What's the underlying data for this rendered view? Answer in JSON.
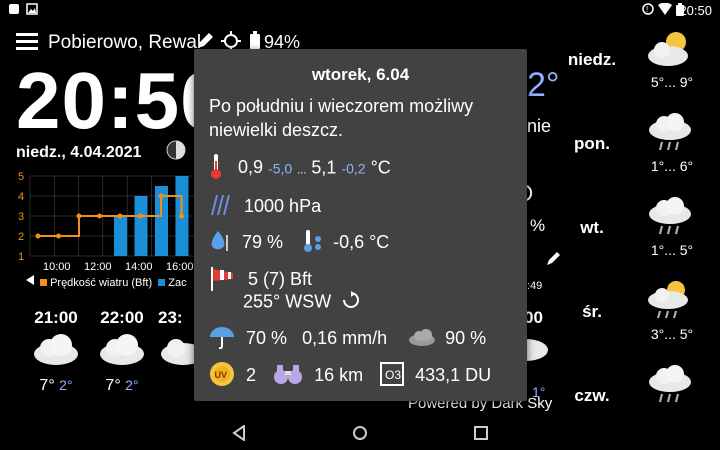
{
  "status": {
    "time": "20:50"
  },
  "header": {
    "location": "Pobierowo, Rewal",
    "battery": "94%"
  },
  "main": {
    "time_partial": "20:50",
    "date": "niedz., 4.04.2021",
    "right_partial_temp": "2°",
    "right_partial_text": "nie",
    "right_partial_percent": "%",
    "right_partial_time": ":49"
  },
  "chart_data": {
    "type": "bar",
    "x": [
      "10:00",
      "12:00",
      "14:00",
      "16:00"
    ],
    "ylim": [
      1,
      5
    ],
    "yticks": [
      "5",
      "4",
      "3",
      "2",
      "1"
    ],
    "xticks": [
      "10:00",
      "12:00",
      "14:00",
      "16:00"
    ],
    "series": [
      {
        "name": "Prędkość wiatru (Bft)",
        "color": "#f0901a",
        "values": [
          2,
          2,
          3,
          3,
          3,
          3,
          4,
          3
        ]
      },
      {
        "name": "Zac",
        "color": "#1a8fd8",
        "values": [
          0,
          0,
          0,
          2,
          3,
          3.5,
          4,
          5,
          4
        ]
      }
    ]
  },
  "legend": {
    "wind": "Prędkość wiatru (Bft)",
    "other": "Zac"
  },
  "hourly": [
    {
      "hour": "21:00",
      "temp": "7°",
      "low": "2°"
    },
    {
      "hour": "22:00",
      "temp": "7°",
      "low": "2°"
    },
    {
      "hour": "23:",
      "temp": "",
      "low": ""
    }
  ],
  "hourly_right": {
    "hour": "00",
    "low": "1°"
  },
  "days": [
    {
      "name": "niedz.",
      "temp": "5°... 9°",
      "icon": "sun-cloud-icon"
    },
    {
      "name": "pon.",
      "temp": "1°... 6°",
      "icon": "rain-cloud-icon"
    },
    {
      "name": "wt.",
      "temp": "1°... 5°",
      "icon": "rain-cloud-icon"
    },
    {
      "name": "śr.",
      "temp": "3°... 5°",
      "icon": "sun-rain-icon"
    },
    {
      "name": "czw.",
      "temp": "",
      "icon": "rain-cloud-icon"
    }
  ],
  "popup": {
    "title": "wtorek, 6.04",
    "description": "Po południu i wieczorem możliwy niewielki deszcz.",
    "temp_min": "0,9",
    "feels_min": "-5,0",
    "dots": "...",
    "temp_max": "5,1",
    "feels_max": "-0,2",
    "temp_unit": "°C",
    "pressure": "1000 hPa",
    "humidity": "79 %",
    "dewpoint": "-0,6 °C",
    "wind_force": "5 (7) Bft",
    "wind_dir": "255° WSW",
    "precip_prob": "70 %",
    "precip_rate": "0,16 mm/h",
    "cloud_cover": "90 %",
    "uv": "2",
    "uv_badge": "UV",
    "visibility": "16 km",
    "ozone": "433,1 DU",
    "ozone_badge": "O3"
  },
  "footer": {
    "powered": "Powered by Dark Sky"
  }
}
